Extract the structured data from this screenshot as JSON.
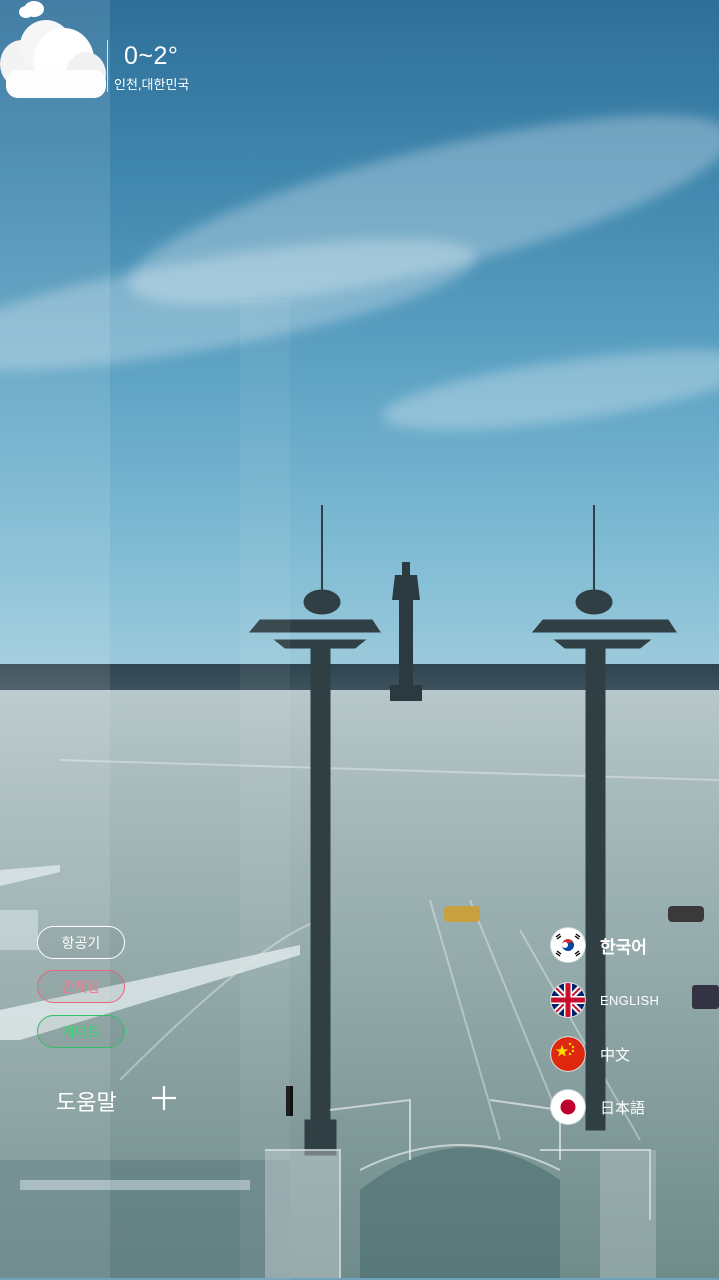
{
  "weather": {
    "temperature": "0~2°",
    "location": "인천,대한민국",
    "icon": "cloud-icon"
  },
  "filters": [
    {
      "label": "항공기",
      "color": "#ffffff"
    },
    {
      "label": "관제탑",
      "color": "#f07b8c"
    },
    {
      "label": "게이트",
      "color": "#34d470"
    }
  ],
  "help": {
    "label": "도움말",
    "icon": "plus-icon"
  },
  "languages": [
    {
      "label": "한국어",
      "flag": "korea-flag-icon",
      "selected": true
    },
    {
      "label": "ENGLISH",
      "flag": "uk-flag-icon",
      "selected": false
    },
    {
      "label": "中文",
      "flag": "china-flag-icon",
      "selected": false
    },
    {
      "label": "日本語",
      "flag": "japan-flag-icon",
      "selected": false
    }
  ]
}
